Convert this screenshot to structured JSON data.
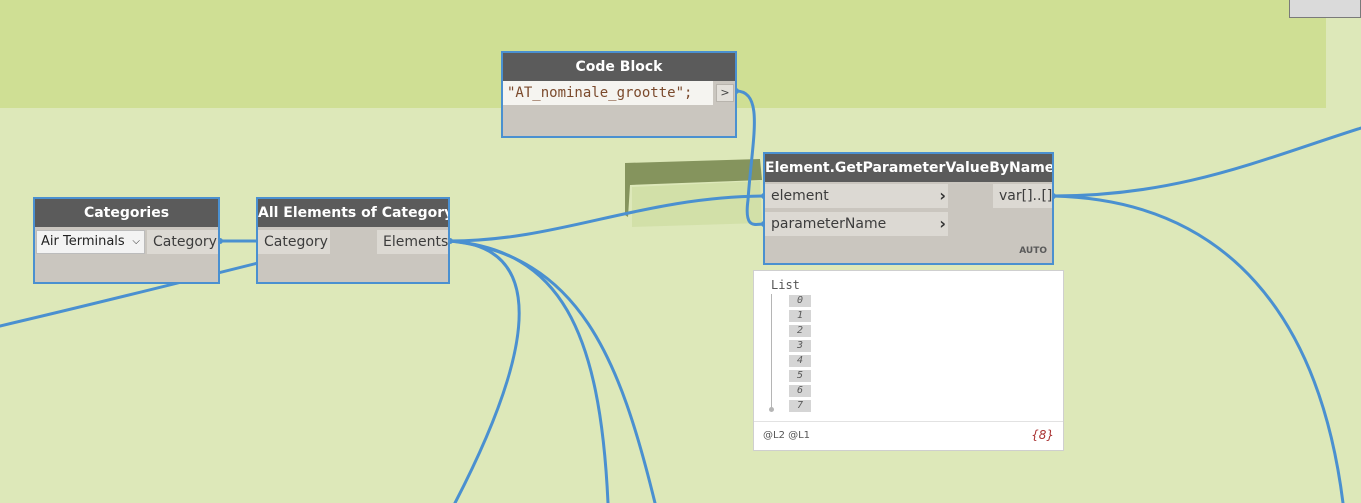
{
  "nodes": {
    "categories": {
      "title": "Categories",
      "dropdown_value": "Air Terminals",
      "output": "Category"
    },
    "all_elements": {
      "title": "All Elements of Category",
      "input": "Category",
      "output": "Elements"
    },
    "code_block": {
      "title": "Code Block",
      "code": "\"AT_nominale_grootte\";",
      "output_symbol": ">"
    },
    "get_param": {
      "title": "Element.GetParameterValueByName",
      "inputs": [
        "element",
        "parameterName"
      ],
      "output": "var[]..[]",
      "lacing": "AUTO"
    }
  },
  "preview": {
    "root_label": "List",
    "indices": [
      "0",
      "1",
      "2",
      "3",
      "4",
      "5",
      "6",
      "7"
    ],
    "levels": "@L2 @L1",
    "count": "{8}"
  },
  "colors": {
    "canvas_bg": "#dde8b9",
    "group_band": "#cfdf94",
    "wire": "#4a90d0",
    "node_header": "#5b5b5b",
    "node_body": "#cac6bf"
  }
}
